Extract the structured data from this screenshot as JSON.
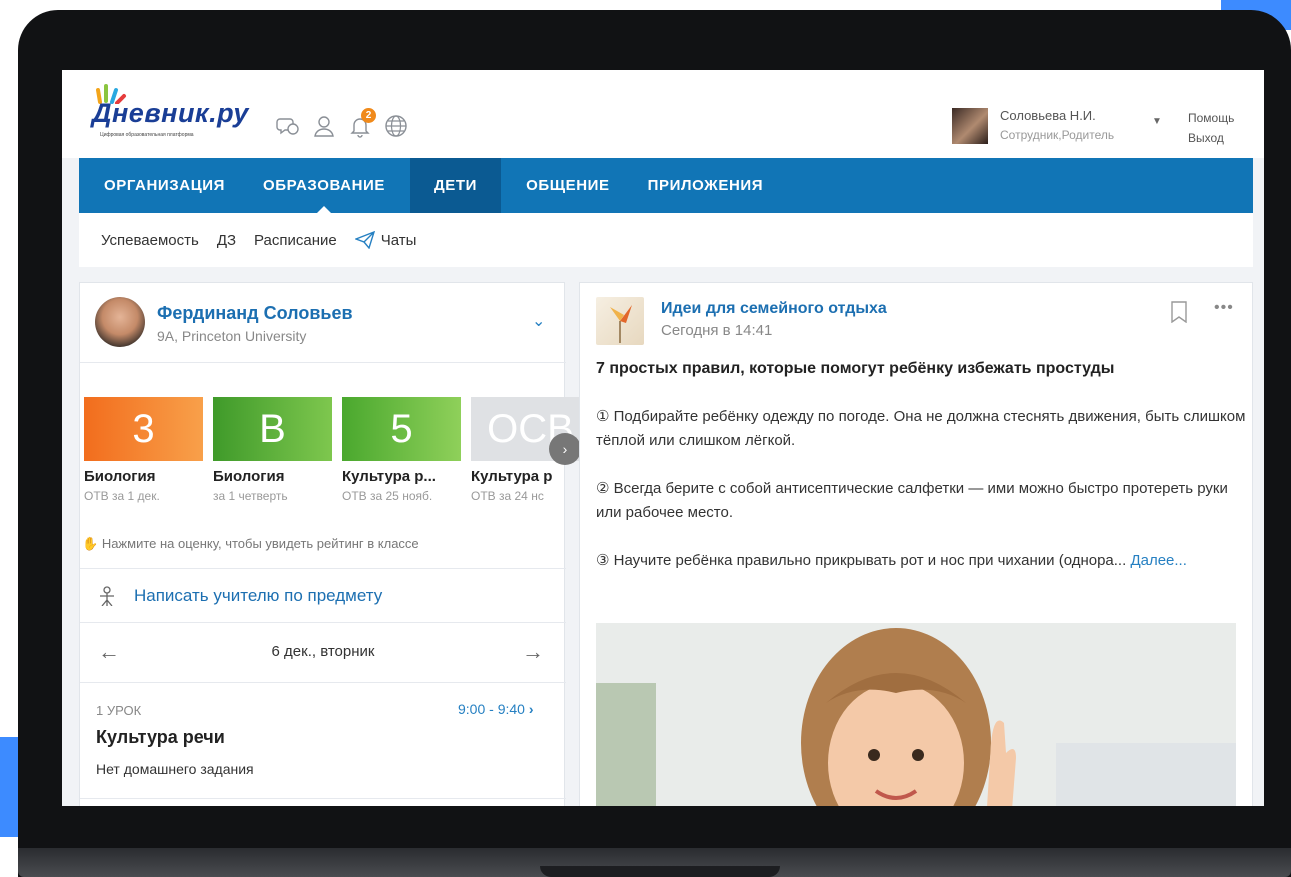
{
  "logo": {
    "text": "Дневник.ру",
    "subtitle": "Цифровая образовательная платформа"
  },
  "header": {
    "notifications_count": "2",
    "user_name": "Соловьева Н.И.",
    "user_role": "Сотрудник,Родитель",
    "help_link": "Помощь",
    "logout_link": "Выход"
  },
  "nav": {
    "items": [
      {
        "label": "ОРГАНИЗАЦИЯ"
      },
      {
        "label": "ОБРАЗОВАНИЕ"
      },
      {
        "label": "ДЕТИ"
      },
      {
        "label": "ОБЩЕНИЕ"
      },
      {
        "label": "ПРИЛОЖЕНИЯ"
      }
    ]
  },
  "subnav": {
    "items": [
      {
        "label": "Успеваемость"
      },
      {
        "label": "ДЗ"
      },
      {
        "label": "Расписание"
      },
      {
        "label": "Чаты"
      }
    ]
  },
  "child": {
    "name": "Фердинанд Соловьев",
    "school": "9А, Princeton University"
  },
  "grades": [
    {
      "value": "3",
      "subject": "Биология",
      "note": "ОТВ за 1 дек.",
      "color": "#f27a1f"
    },
    {
      "value": "В",
      "subject": "Биология",
      "note": "за 1 четверть",
      "color": "#4fa52f"
    },
    {
      "value": "5",
      "subject": "Культура р...",
      "note": "ОТВ за 25 нояб.",
      "color": "#58b231"
    },
    {
      "value": "ОСВ",
      "subject": "Культура р",
      "note": "ОТВ за 24 нс",
      "color": "#d9dbde"
    }
  ],
  "grades_hint": "Нажмите на оценку, чтобы увидеть рейтинг в классе",
  "write_teacher": "Написать учителю по предмету",
  "schedule": {
    "date": "6 дек., вторник",
    "lesson_number": "1 УРОК",
    "lesson_time": "9:00 - 9:40",
    "lesson_subject": "Культура речи",
    "lesson_homework": "Нет домашнего задания"
  },
  "post": {
    "source": "Идеи для семейного отдыха",
    "time": "Сегодня в 14:41",
    "title": "7 простых правил, которые помогут ребёнку избежать простуды",
    "paragraphs": [
      "① Подбирайте ребёнку одежду по погоде. Она не должна стеснять движения, быть слишком тёплой или слишком лёгкой.",
      "② Всегда берите с собой антисептические салфетки — ими можно быстро протереть руки или рабочее место.",
      "③ Научите ребёнка правильно прикрывать рот и нос при чихании (однора..."
    ],
    "more_link": "Далее..."
  },
  "colors": {
    "nav_bg": "#1175b6",
    "nav_active": "#0b5a92",
    "link_blue": "#1c6fb1",
    "badge_orange": "#f08a1b"
  }
}
